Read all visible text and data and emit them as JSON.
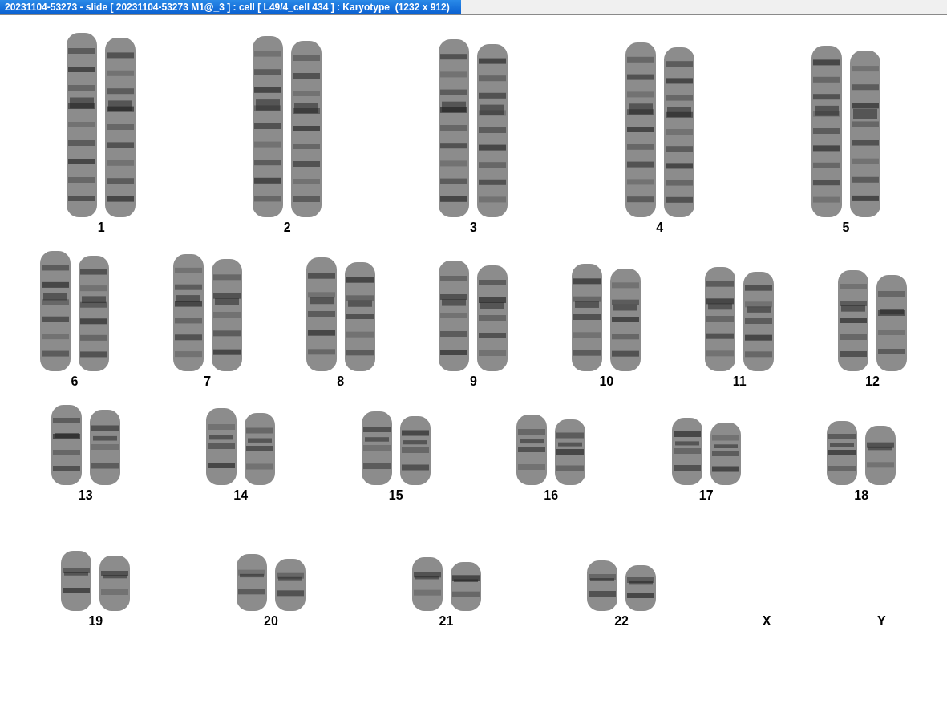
{
  "window": {
    "title": "20231104-53273 - slide [ 20231104-53273 M1@_3 ] : cell [ L49/4_cell 434 ] : Karyotype  (1232 x 912)"
  },
  "karyotype": {
    "rows": [
      {
        "pairs": [
          {
            "label": "1",
            "present": true
          },
          {
            "label": "2",
            "present": true
          },
          {
            "label": "3",
            "present": true
          },
          {
            "label": "4",
            "present": true
          },
          {
            "label": "5",
            "present": true
          }
        ]
      },
      {
        "pairs": [
          {
            "label": "6",
            "present": true
          },
          {
            "label": "7",
            "present": true
          },
          {
            "label": "8",
            "present": true
          },
          {
            "label": "9",
            "present": true
          },
          {
            "label": "10",
            "present": true
          },
          {
            "label": "11",
            "present": true
          },
          {
            "label": "12",
            "present": true
          }
        ]
      },
      {
        "pairs": [
          {
            "label": "13",
            "present": true
          },
          {
            "label": "14",
            "present": true
          },
          {
            "label": "15",
            "present": true
          },
          {
            "label": "16",
            "present": true
          },
          {
            "label": "17",
            "present": true
          },
          {
            "label": "18",
            "present": true
          }
        ]
      },
      {
        "pairs": [
          {
            "label": "19",
            "present": true
          },
          {
            "label": "20",
            "present": true
          },
          {
            "label": "21",
            "present": true
          },
          {
            "label": "22",
            "present": true
          },
          {
            "label": "X",
            "present": false
          },
          {
            "label": "Y",
            "present": false
          }
        ]
      }
    ]
  }
}
